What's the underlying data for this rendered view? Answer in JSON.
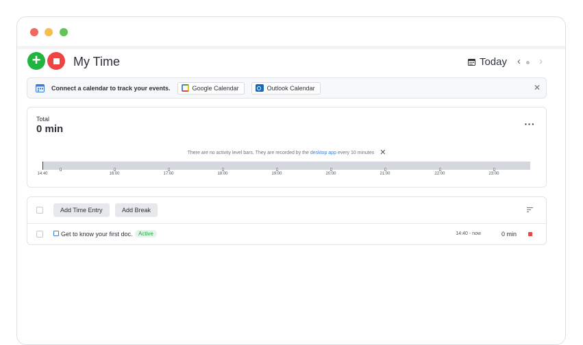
{
  "window": {
    "controls": [
      "close",
      "minimize",
      "maximize"
    ]
  },
  "header": {
    "title": "My Time",
    "date_label": "Today",
    "prev_icon": "‹",
    "next_icon": "›"
  },
  "connect": {
    "message": "Connect a calendar to track your events.",
    "google_label": "Google Calendar",
    "outlook_label": "Outlook Calendar"
  },
  "total": {
    "label": "Total",
    "value": "0 min",
    "notice_prefix": "There are no activity level bars. They are recorded by the",
    "notice_link": "desktop app",
    "notice_suffix": "every 10 minutes",
    "timeline_ticks": [
      "14:40",
      "16:00",
      "17:00",
      "18:00",
      "19:00",
      "20:00",
      "21:00",
      "22:00",
      "23:00"
    ]
  },
  "entries": {
    "add_time_entry_label": "Add Time Entry",
    "add_break_label": "Add Break",
    "rows": [
      {
        "title": "Get to know your first doc.",
        "status": "Active",
        "time_range": "14:40 - now",
        "duration": "0 min"
      }
    ]
  },
  "colors": {
    "accent_green": "#1fb53f",
    "accent_red": "#ee4444",
    "link_blue": "#3b7bd8"
  }
}
